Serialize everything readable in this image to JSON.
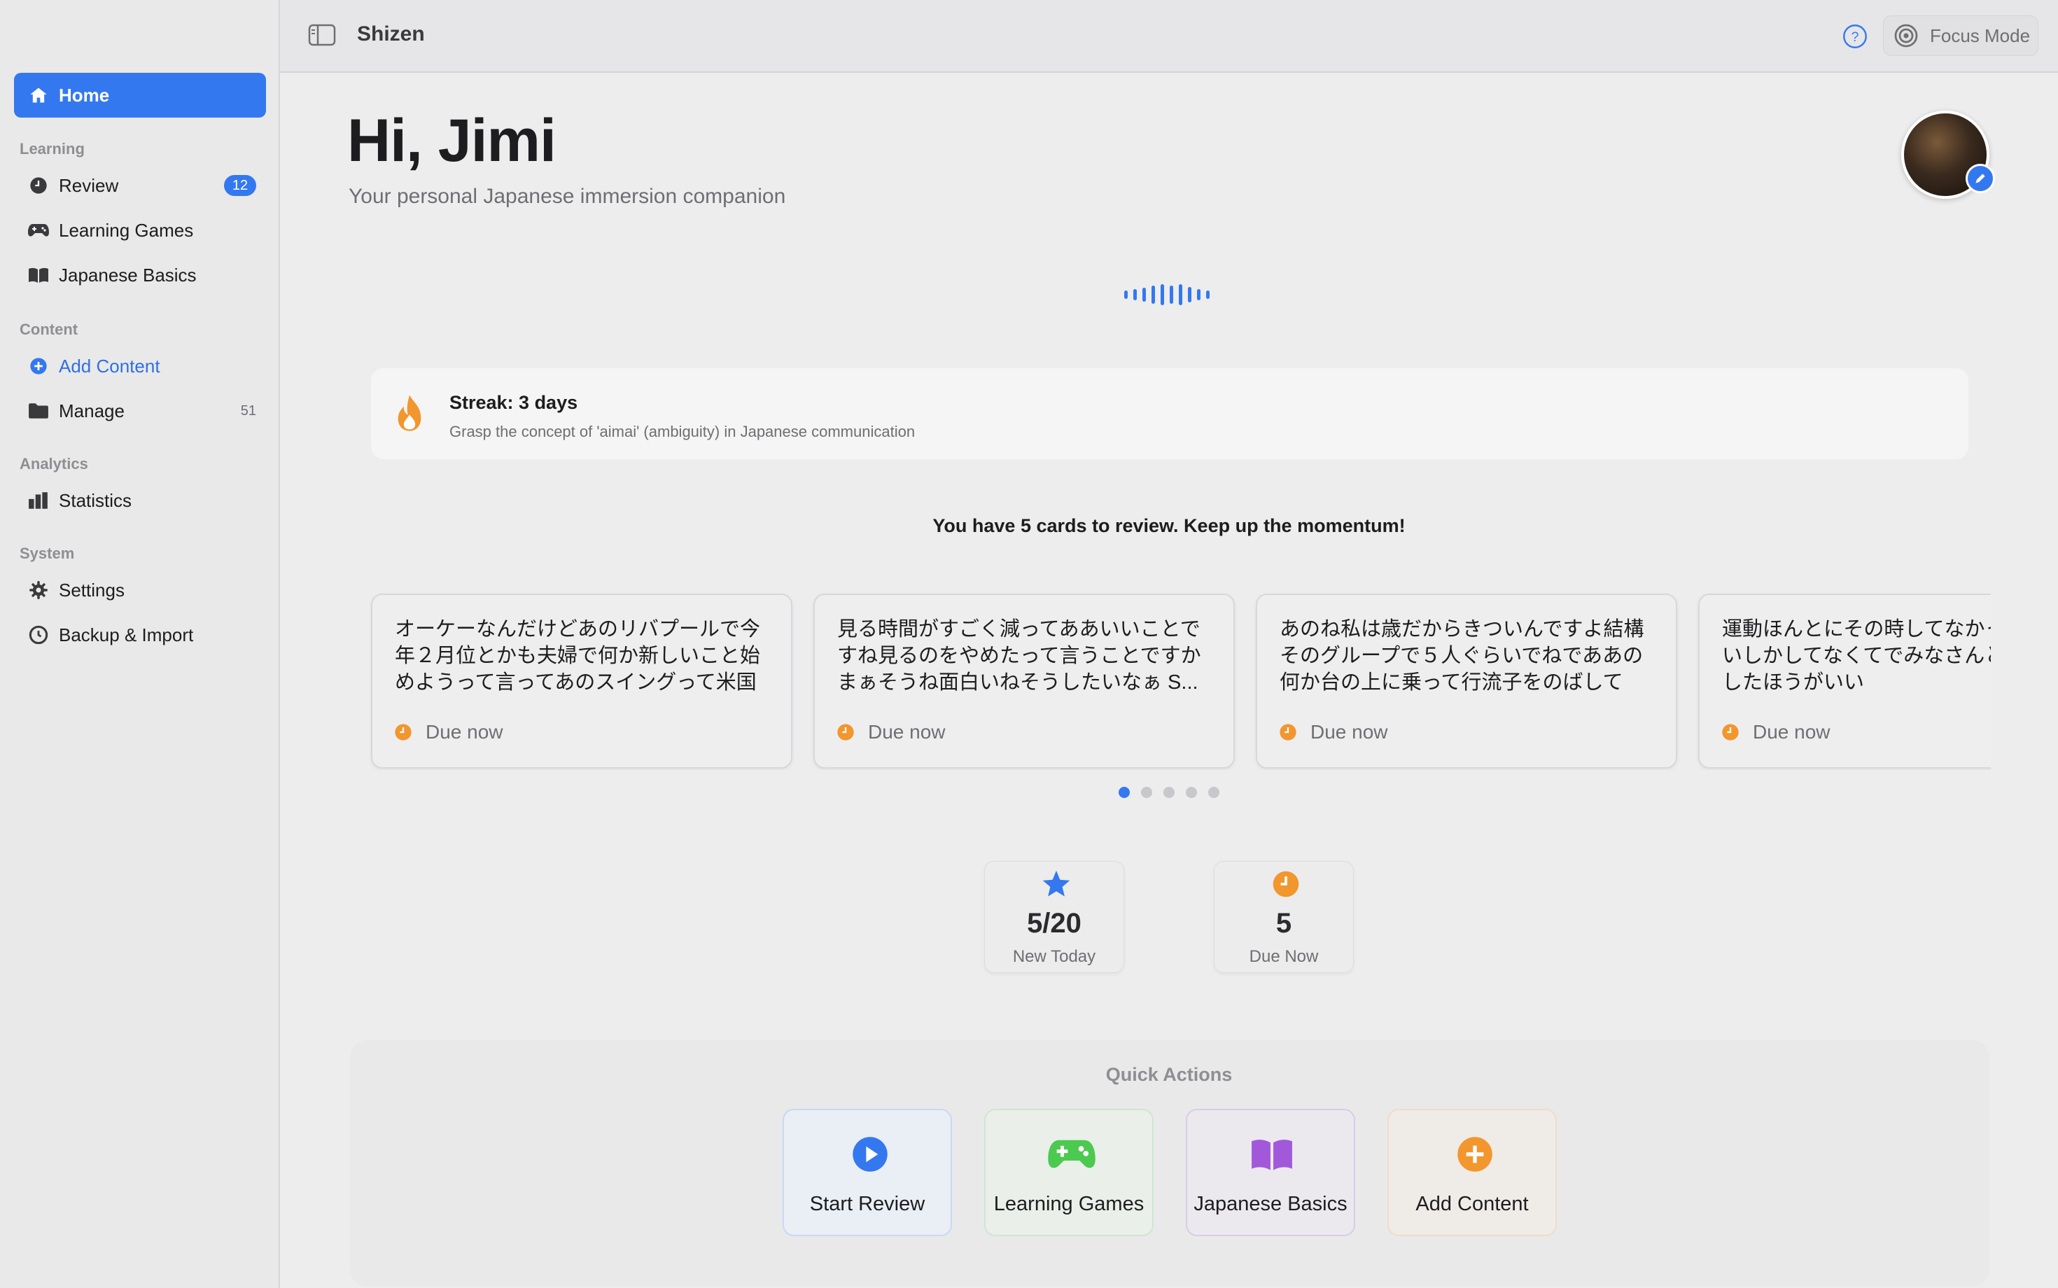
{
  "app": {
    "title": "Shizen"
  },
  "topbar": {
    "focus_label": "Focus Mode"
  },
  "sidebar": {
    "home": "Home",
    "sections": {
      "learning": "Learning",
      "content": "Content",
      "analytics": "Analytics",
      "system": "System"
    },
    "items": {
      "review": {
        "label": "Review",
        "badge": "12"
      },
      "learning_games": {
        "label": "Learning Games"
      },
      "japanese_basics": {
        "label": "Japanese Basics"
      },
      "add_content": {
        "label": "Add Content"
      },
      "manage": {
        "label": "Manage",
        "count": "51"
      },
      "statistics": {
        "label": "Statistics"
      },
      "settings": {
        "label": "Settings"
      },
      "backup_import": {
        "label": "Backup & Import"
      }
    }
  },
  "header": {
    "greeting": "Hi, Jimi",
    "subtitle": "Your personal Japanese immersion companion"
  },
  "streak": {
    "title": "Streak: 3 days",
    "description": "Grasp the concept of 'aimai' (ambiguity) in Japanese communication"
  },
  "review_message": "You have 5 cards to review. Keep up the momentum!",
  "cards": [
    {
      "text": "オーケーなんだけどあのリバプールで今年２月位とかも夫婦で何か新しいこと始めようって言ってあのスイングって米国",
      "due": "Due now"
    },
    {
      "text": "見る時間がすごく減ってああいいことですね見るのをやめたって言うことですかまぁそうね面白いねそうしたいなぁ S...",
      "due": "Due now"
    },
    {
      "text": "あのね私は歳だからきついんですよ結構そのグループで５人ぐらいでねでああの何か台の上に乗って行流子をのばして",
      "due": "Due now"
    },
    {
      "text": "運動ほんとにその時してなかったくぐらいしかしてなくてでみなさんとかにヨガしたほうがいい",
      "due": "Due now"
    }
  ],
  "pagination": {
    "total": 5,
    "active": 0
  },
  "stats": {
    "new_today": {
      "value": "5/20",
      "label": "New Today"
    },
    "due_now": {
      "value": "5",
      "label": "Due Now"
    }
  },
  "quick_actions": {
    "title": "Quick Actions",
    "items": [
      {
        "label": "Start Review",
        "icon": "play-icon",
        "color": "#3478f0"
      },
      {
        "label": "Learning Games",
        "icon": "gamepad-icon",
        "color": "#4cc94f"
      },
      {
        "label": "Japanese Basics",
        "icon": "book-icon",
        "color": "#a259d9"
      },
      {
        "label": "Add Content",
        "icon": "plus-icon",
        "color": "#f2962e"
      }
    ]
  },
  "colors": {
    "accent": "#3478f0",
    "orange": "#f2962e",
    "green": "#4cc94f",
    "purple": "#a259d9"
  }
}
